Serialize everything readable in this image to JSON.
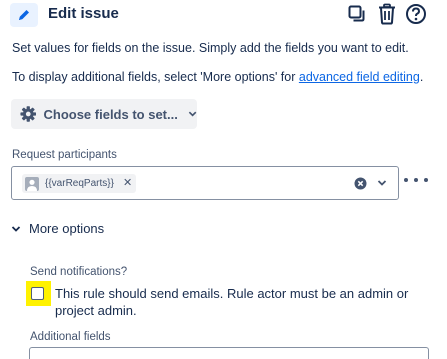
{
  "header": {
    "title": "Edit issue",
    "icons": [
      "pencil-icon",
      "duplicate-icon",
      "trash-icon",
      "help-icon"
    ]
  },
  "description": {
    "line1": "Set values for fields on the issue. Simply add the fields you want to edit.",
    "line2_prefix": "To display additional fields, select 'More options' for ",
    "line2_link": "advanced field editing",
    "line2_suffix": "."
  },
  "choose_fields_button": {
    "label": "Choose fields to set..."
  },
  "request_participants": {
    "label": "Request participants",
    "chip": "{{varReqParts}}"
  },
  "more_options": {
    "label": "More options"
  },
  "send_notifications": {
    "label": "Send notifications?",
    "checkbox_checked": false,
    "checkbox_text": "This rule should send emails. Rule actor must be an admin or project admin."
  },
  "additional_fields": {
    "label": "Additional fields"
  },
  "colors": {
    "link": "#0c66e4",
    "highlight": "#fff200",
    "text": "#172b4d"
  }
}
